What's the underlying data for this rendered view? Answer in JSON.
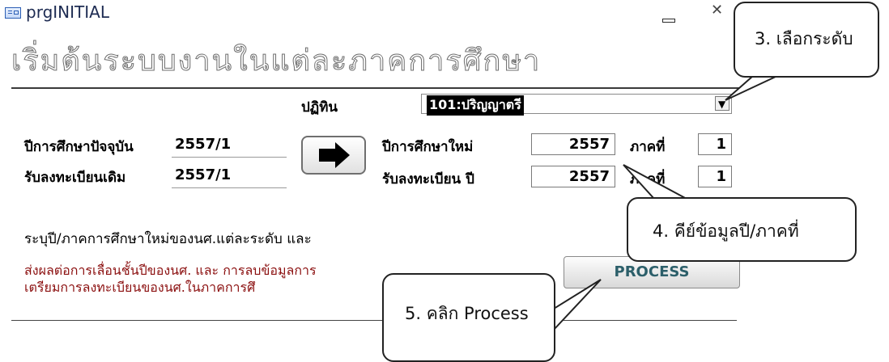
{
  "window": {
    "title": "prgINITIAL",
    "heading": "เริ่มต้นระบบงานในแต่ละภาคการศึกษา"
  },
  "form": {
    "level_label": "ปฏิทิน",
    "level_value": "101:ปริญญาตรี",
    "current_year_label": "ปีการศึกษาปัจจุบัน",
    "current_year_value": "2557/1",
    "prev_reg_label": "รับลงทะเบียนเดิม",
    "prev_reg_value": "2557/1",
    "new_year_label": "ปีการศึกษาใหม่",
    "new_year_value": "2557",
    "term_label": "ภาคที่",
    "term_value": "1",
    "reg_year_label": "รับลงทะเบียน ปี",
    "reg_year_value": "2557",
    "reg_term_label": "ภาคที่",
    "reg_term_value": "1",
    "instruction": "ระบุปี/ภาคการศึกษาใหม่ของนศ.แต่ละระดับ และ",
    "warning_line1": "ส่งผลต่อการเลื่อนชั้นปีของนศ. และ การลบข้อมูลการ",
    "warning_line2": "เตรียมการลงทะเบียนของนศ.ในภาคการศึ",
    "process_label": "PROCESS"
  },
  "callouts": {
    "step3": "3. เลือกระดับ",
    "step4": "4. คีย์ข้อมูลปี/ภาคที่",
    "step5": "5. คลิก Process"
  },
  "icons": {
    "arrow": "right-arrow-icon",
    "dropdown": "chevron-down-icon",
    "minimize": "minimize-icon",
    "close": "close-icon"
  }
}
